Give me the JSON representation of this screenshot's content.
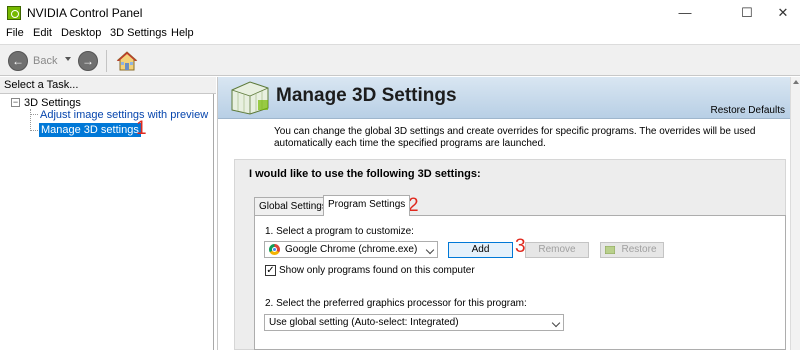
{
  "window": {
    "title": "NVIDIA Control Panel",
    "minimize_glyph": "—",
    "maximize_glyph": "☐",
    "close_glyph": "✕"
  },
  "menu": {
    "items": [
      "File",
      "Edit",
      "Desktop",
      "3D Settings",
      "Help"
    ]
  },
  "toolbar": {
    "back_label": "Back",
    "back_glyph": "←",
    "forward_glyph": "→"
  },
  "task_pane": {
    "header": "Select a Task...",
    "tree_toggle": "−",
    "root_label": "3D Settings",
    "items": [
      {
        "label": "Adjust image settings with preview",
        "selected": false
      },
      {
        "label": "Manage 3D settings",
        "selected": true
      }
    ]
  },
  "annotations": [
    "1",
    "2",
    "3"
  ],
  "main": {
    "title": "Manage 3D Settings",
    "restore_defaults": "Restore Defaults",
    "description": "You can change the global 3D settings and create overrides for specific programs. The overrides will be used automatically each time the specified programs are launched.",
    "section_title": "I would like to use the following 3D settings:",
    "tabs": [
      {
        "label": "Global Settings",
        "active": false
      },
      {
        "label": "Program Settings",
        "active": true
      }
    ],
    "step1_label": "1. Select a program to customize:",
    "program_select_value": "Google Chrome (chrome.exe)",
    "buttons": {
      "add": "Add",
      "remove": "Remove",
      "restore": "Restore"
    },
    "show_only_checkbox": {
      "label": "Show only programs found on this computer",
      "checked": true,
      "mark": "✓"
    },
    "step2_label": "2. Select the preferred graphics processor for this program:",
    "gpu_select_value": "Use global setting (Auto-select: Integrated)"
  },
  "colors": {
    "selection": "#0078d7",
    "annotation": "#e0291e",
    "nvidia_green": "#76b900",
    "link": "#0645ad"
  }
}
